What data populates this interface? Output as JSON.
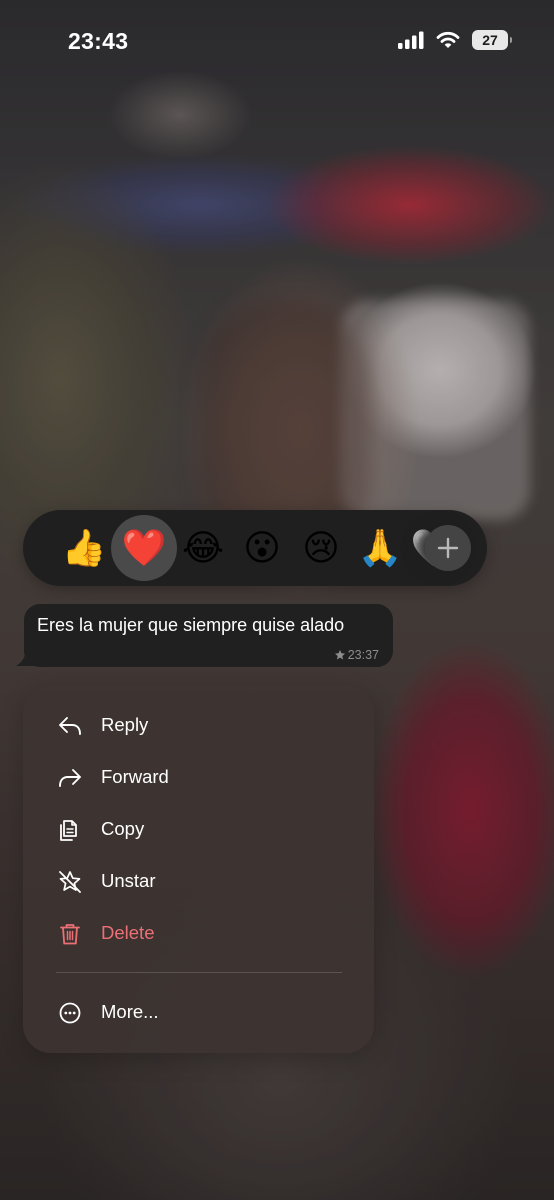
{
  "status_bar": {
    "time": "23:43",
    "battery": "27",
    "icons": [
      "signal-icon",
      "wifi-icon",
      "battery-icon"
    ]
  },
  "reactions": {
    "emojis": [
      {
        "name": "thumbs-up-emoji",
        "glyph": "👍",
        "selected": false
      },
      {
        "name": "red-heart-emoji",
        "glyph": "❤️",
        "selected": true
      },
      {
        "name": "tears-of-joy-emoji",
        "glyph": "😂",
        "selected": false
      },
      {
        "name": "surprised-emoji",
        "glyph": "😮",
        "selected": false
      },
      {
        "name": "crying-emoji",
        "glyph": "😢",
        "selected": false
      },
      {
        "name": "folded-hands-emoji",
        "glyph": "🙏",
        "selected": false
      },
      {
        "name": "white-heart-emoji",
        "glyph": "🤍",
        "selected": false
      }
    ],
    "more_icon": "plus-icon"
  },
  "message": {
    "text": "Eres la mujer que siempre quise alado",
    "time": "23:37",
    "starred": true
  },
  "menu": {
    "items": [
      {
        "label": "Reply",
        "icon": "reply-icon"
      },
      {
        "label": "Forward",
        "icon": "forward-icon"
      },
      {
        "label": "Copy",
        "icon": "copy-icon"
      },
      {
        "label": "Unstar",
        "icon": "unstar-icon"
      },
      {
        "label": "Delete",
        "icon": "trash-icon",
        "color": "#ea7076"
      },
      {
        "label": "More...",
        "icon": "more-icon"
      }
    ]
  },
  "colors": {
    "menu_bg": "#3e3432",
    "bubble_bg": "#202020",
    "reaction_bar_bg": "#1f1f1f",
    "danger": "#ea7076"
  }
}
